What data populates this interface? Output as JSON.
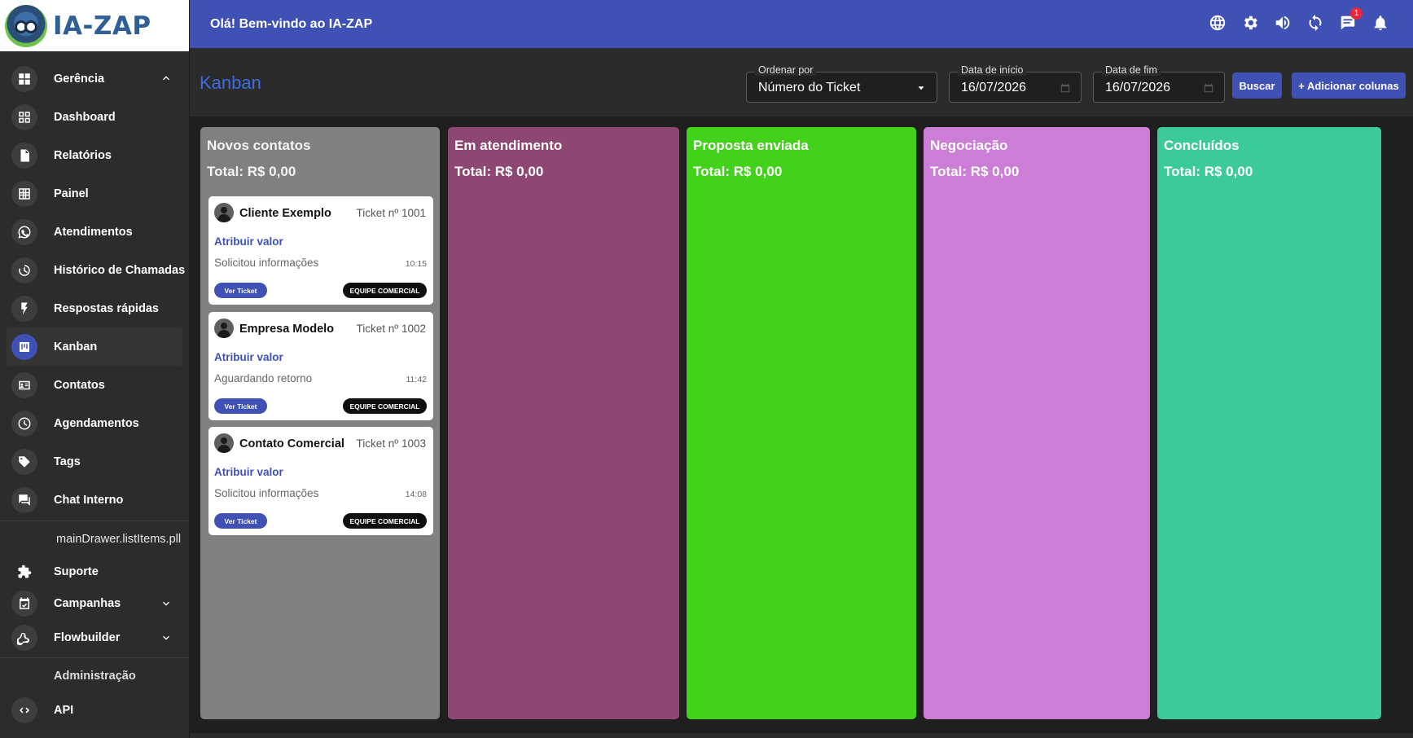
{
  "brand": {
    "name": "IA-ZAP"
  },
  "header": {
    "greeting": "Olá! Bem-vindo ao IA-ZAP",
    "chat_badge": "1"
  },
  "sidebar": {
    "items": [
      {
        "label": "Gerência",
        "icon": "dashboard-grid-icon"
      },
      {
        "label": "Dashboard",
        "icon": "dashboard-icon"
      },
      {
        "label": "Relatórios",
        "icon": "document-icon"
      },
      {
        "label": "Painel",
        "icon": "grid-icon"
      },
      {
        "label": "Atendimentos",
        "icon": "whatsapp-icon"
      },
      {
        "label": "Histórico de Chamadas",
        "icon": "history-icon"
      },
      {
        "label": "Respostas rápidas",
        "icon": "flash-icon"
      },
      {
        "label": "Kanban",
        "icon": "kanban-icon"
      },
      {
        "label": "Contatos",
        "icon": "contacts-icon"
      },
      {
        "label": "Agendamentos",
        "icon": "clock-icon"
      },
      {
        "label": "Tags",
        "icon": "tag-icon"
      },
      {
        "label": "Chat Interno",
        "icon": "chat-icon"
      }
    ],
    "subheader_pll": "mainDrawer.listItems.pll",
    "items2": [
      {
        "label": "Suporte",
        "icon": "puzzle-icon"
      },
      {
        "label": "Campanhas",
        "icon": "calendar-check-icon"
      },
      {
        "label": "Flowbuilder",
        "icon": "webhook-icon"
      }
    ],
    "subheader_admin": "Administração",
    "items3": [
      {
        "label": "API",
        "icon": "code-icon"
      }
    ]
  },
  "toolbar": {
    "title": "Kanban",
    "order_label": "Ordenar por",
    "order_value": "Número do Ticket",
    "start_label": "Data de início",
    "start_value": "16/07/2026",
    "end_label": "Data de fim",
    "end_value": "16/07/2026",
    "search_label": "Buscar",
    "add_columns_label": "+ Adicionar colunas"
  },
  "lanes": [
    {
      "title": "Novos contatos",
      "total": "Total: R$ 0,00",
      "color": "#808080"
    },
    {
      "title": "Em atendimento",
      "total": "Total: R$ 0,00",
      "color": "#8e4672"
    },
    {
      "title": "Proposta enviada",
      "total": "Total: R$ 0,00",
      "color": "#43d21c"
    },
    {
      "title": "Negociação",
      "total": "Total: R$ 0,00",
      "color": "#cc7dd6"
    },
    {
      "title": "Concluídos",
      "total": "Total: R$ 0,00",
      "color": "#3cc99c"
    }
  ],
  "cards": [
    {
      "name": "Cliente Exemplo",
      "ticket": "Ticket nº 1001",
      "assign": "Atribuir valor",
      "message": "Solicitou informações",
      "time": "10:15",
      "view": "Ver Ticket",
      "team": "EQUIPE COMERCIAL"
    },
    {
      "name": "Empresa Modelo",
      "ticket": "Ticket nº 1002",
      "assign": "Atribuir valor",
      "message": "Aguardando retorno",
      "time": "11:42",
      "view": "Ver Ticket",
      "team": "EQUIPE COMERCIAL"
    },
    {
      "name": "Contato Comercial",
      "ticket": "Ticket nº 1003",
      "assign": "Atribuir valor",
      "message": "Solicitou informações",
      "time": "14:08",
      "view": "Ver Ticket",
      "team": "EQUIPE COMERCIAL"
    }
  ],
  "colors": {
    "primary": "#3f51b5",
    "sidebar_bg": "#2c2c2c",
    "board_bg": "#1f1f1f"
  }
}
